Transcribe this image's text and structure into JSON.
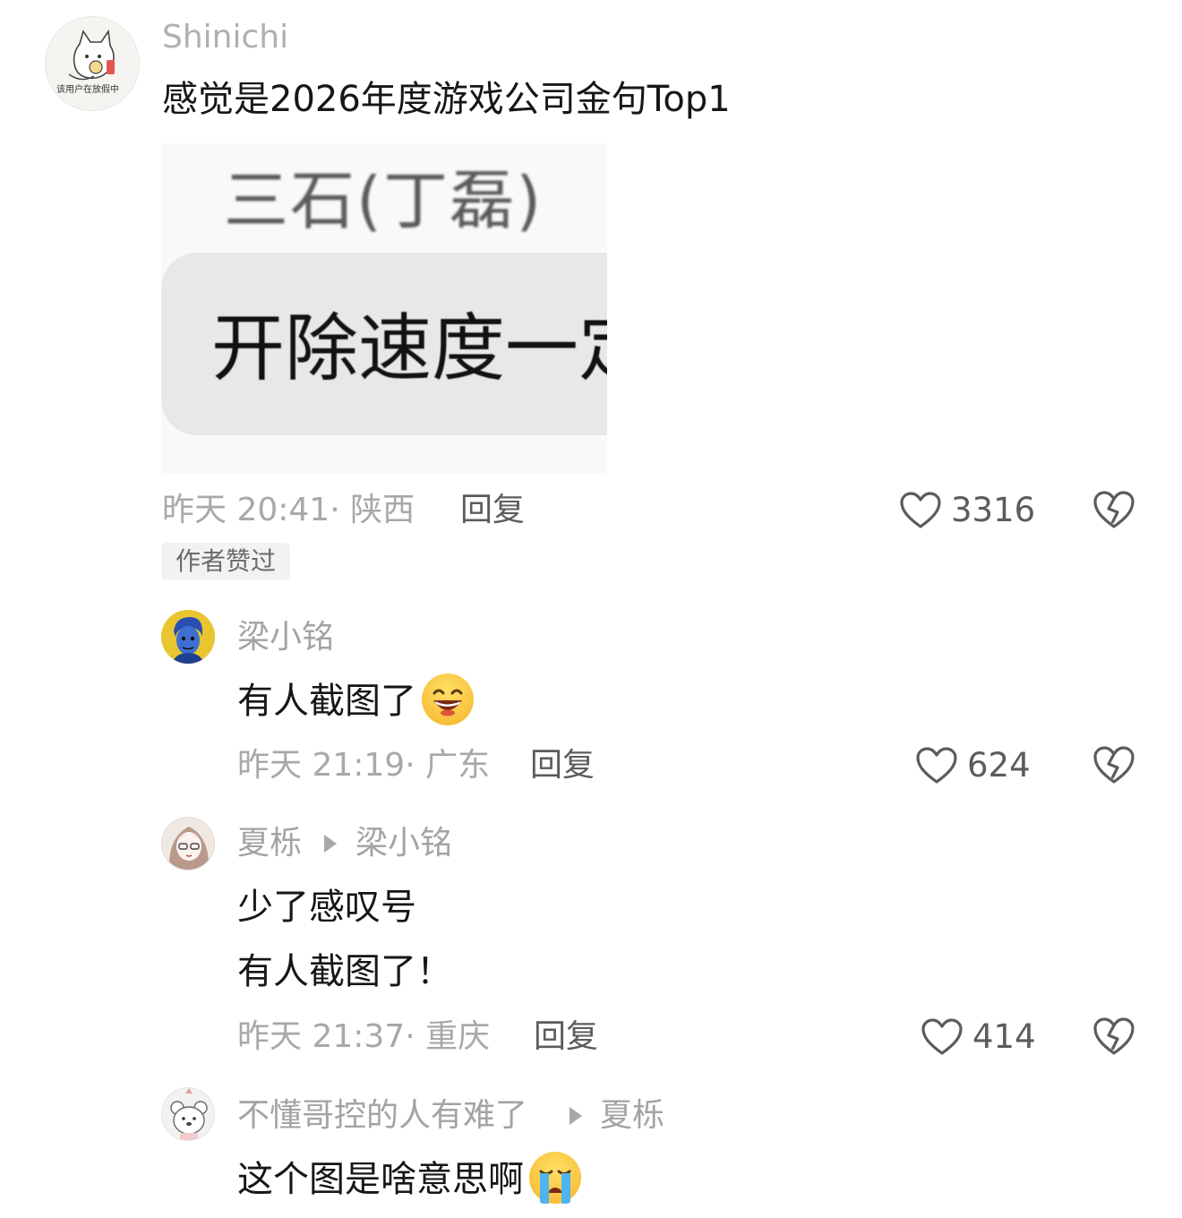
{
  "comments": [
    {
      "username": "Shinichi",
      "avatar_badge": "该用户在放假中",
      "text": "感觉是2026年度游戏公司金句Top1",
      "image": {
        "name": "三石(丁磊)",
        "message": "开除速度一定"
      },
      "meta": "昨天 20:41· 陕西",
      "reply_label": "回复",
      "likes": "3316",
      "badge": "作者赞过"
    },
    {
      "username": "梁小铭",
      "text": "有人截图了",
      "emoji": "grin-emoji",
      "meta": "昨天 21:19· 广东",
      "reply_label": "回复",
      "likes": "624"
    },
    {
      "username": "夏栎",
      "reply_to": "梁小铭",
      "text_line1": "少了感叹号",
      "text_line2": "有人截图了！",
      "meta": "昨天 21:37· 重庆",
      "reply_label": "回复",
      "likes": "414"
    },
    {
      "username": "不懂哥控的人有难了",
      "reply_to": "夏栎",
      "text": "这个图是啥意思啊",
      "emoji": "crying-emoji"
    }
  ],
  "colors": {
    "username": "#a3a3a3",
    "text": "#161616",
    "meta": "#a8a8a8",
    "action": "#5c5c5c",
    "badge_bg": "#f2f2f2"
  },
  "icons": [
    "heart-icon",
    "dislike-icon",
    "reply-arrow-icon"
  ]
}
